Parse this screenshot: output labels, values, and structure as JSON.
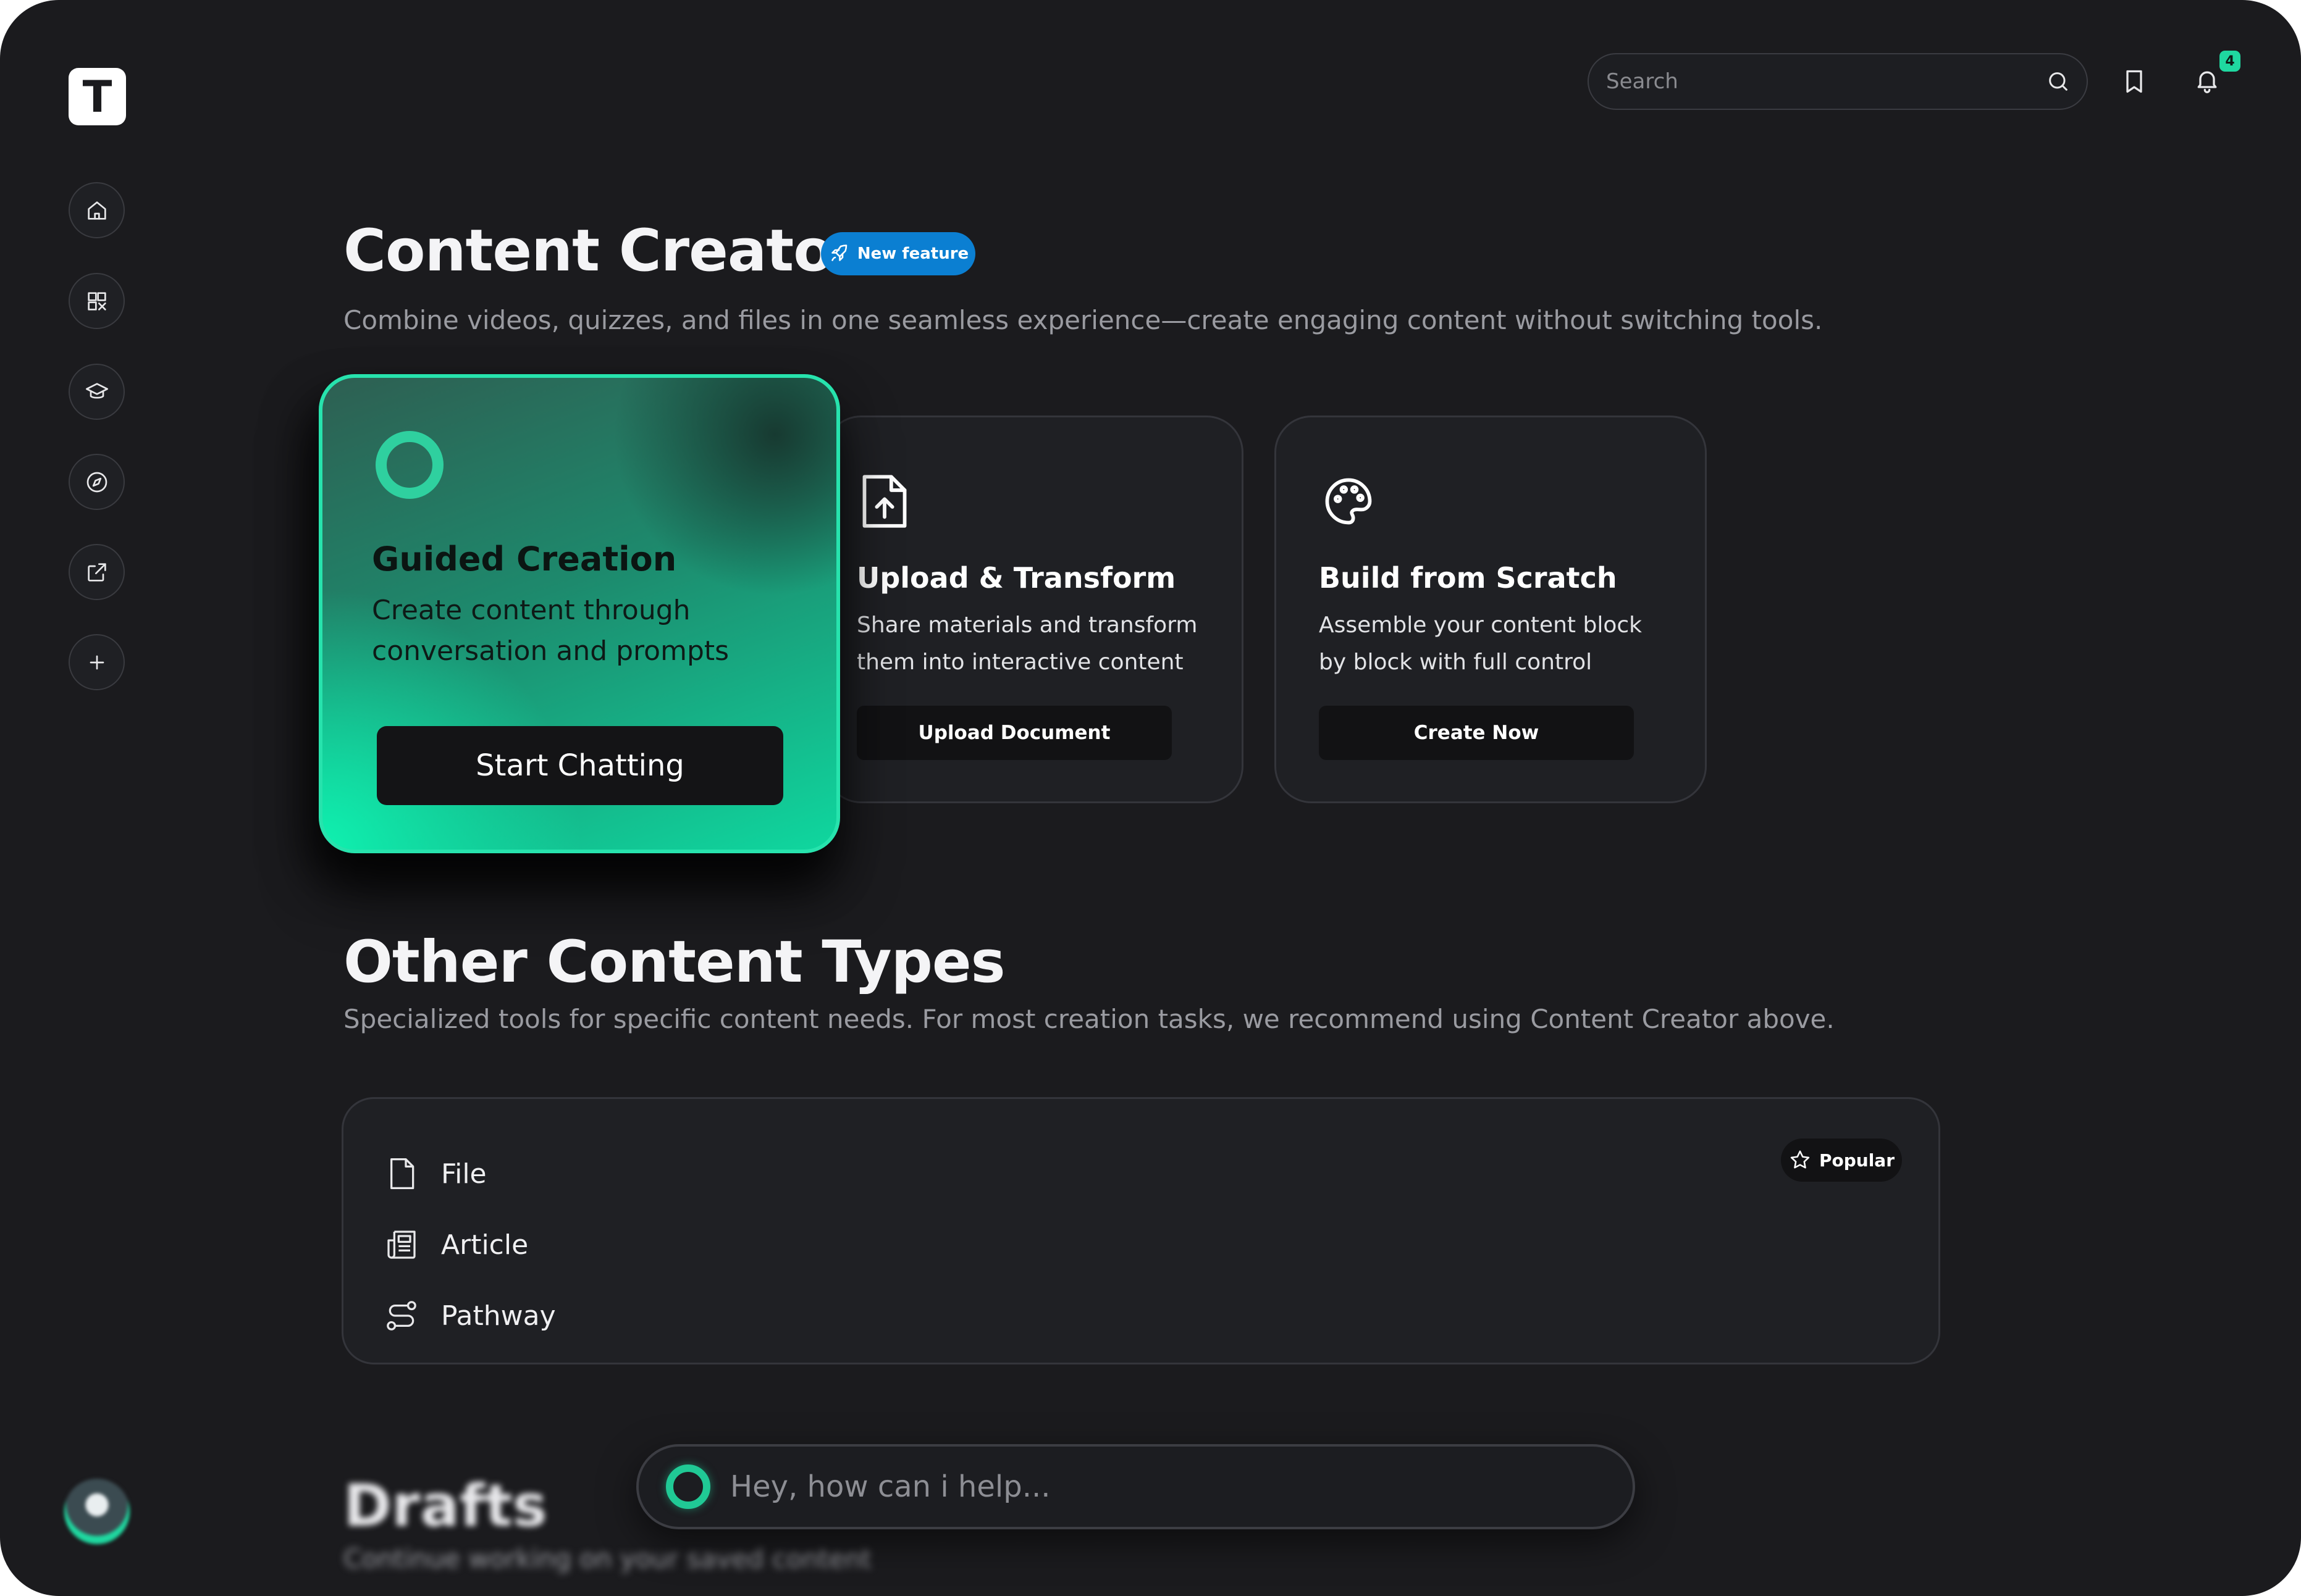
{
  "app": {
    "logo_letter": "T"
  },
  "sidebar": {
    "items": [
      {
        "name": "home",
        "icon": "home-icon"
      },
      {
        "name": "library",
        "icon": "library-icon"
      },
      {
        "name": "learning",
        "icon": "graduation-cap-icon"
      },
      {
        "name": "explore",
        "icon": "compass-icon"
      },
      {
        "name": "external",
        "icon": "external-link-icon"
      },
      {
        "name": "add",
        "icon": "plus-icon"
      }
    ]
  },
  "header": {
    "search_placeholder": "Search",
    "notification_count": "4"
  },
  "hero": {
    "title": "Content Creator",
    "badge": "New feature",
    "subtitle": "Combine videos, quizzes, and files in one seamless experience—create engaging content without switching tools."
  },
  "cards": {
    "guided": {
      "title": "Guided Creation",
      "desc_line1": "Create content through",
      "desc_line2": "conversation and prompts",
      "button": "Start Chatting"
    },
    "upload": {
      "title": "Upload & Transform",
      "desc_line1": "Share materials and transform",
      "desc_line2": "them into interactive content",
      "button": "Upload Document"
    },
    "scratch": {
      "title": "Build from Scratch",
      "desc_line1": "Assemble your content block",
      "desc_line2": "by block with full control",
      "button": "Create Now"
    }
  },
  "other_types": {
    "title": "Other Content Types",
    "subtitle": "Specialized tools for specific content needs. For most creation tasks, we recommend using Content Creator above.",
    "popular_badge": "Popular",
    "items": [
      {
        "label": "File",
        "icon": "file-icon"
      },
      {
        "label": "Article",
        "icon": "newspaper-icon"
      },
      {
        "label": "Pathway",
        "icon": "route-icon"
      }
    ]
  },
  "drafts": {
    "title": "Drafts",
    "subtitle": "Continue working on your saved content"
  },
  "chat": {
    "placeholder": "Hey, how can i help..."
  },
  "colors": {
    "background": "#1b1b1e",
    "accent": "#1fd8a0",
    "badge_blue": "#0b7fd2",
    "card": "#1f2024"
  }
}
